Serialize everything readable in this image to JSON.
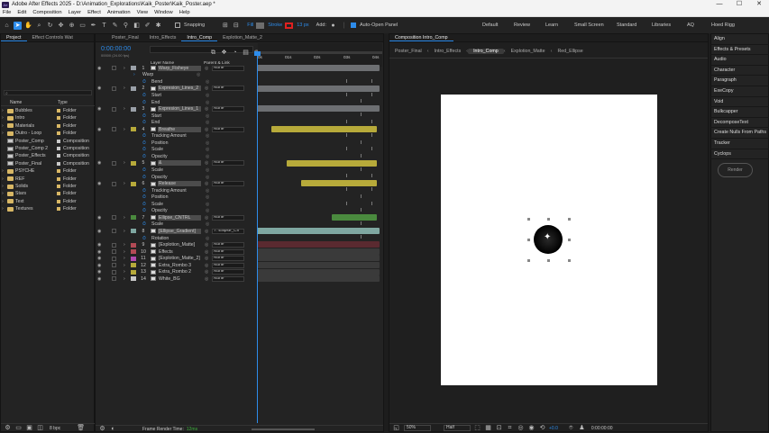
{
  "app": {
    "window_title": "Adobe After Effects 2025 - D:\\Animation_Explorations\\Kaik_Poster\\Kaik_Poster.aep *",
    "icon": "Ae"
  },
  "window_buttons": [
    "—",
    "☐",
    "✕"
  ],
  "menu": [
    "File",
    "Edit",
    "Composition",
    "Layer",
    "Effect",
    "Animation",
    "View",
    "Window",
    "Help"
  ],
  "toolbar": {
    "snapping": "Snapping",
    "fill": "Fill",
    "stroke": "Stroke",
    "stroke_width": "13 px",
    "add": "Add:",
    "auto_open": "Auto-Open Panel",
    "workspaces": [
      "Default",
      "Review",
      "Learn",
      "Small Screen",
      "Standard",
      "Libraries",
      "AQ",
      "Hoed Rigg"
    ]
  },
  "project": {
    "tabs": [
      "Project",
      "Effect Controls Wat"
    ],
    "search_placeholder": "",
    "col_name": "Name",
    "col_type": "Type",
    "items": [
      {
        "name": "Bubbles",
        "type": "Folder",
        "kind": "folder"
      },
      {
        "name": "Intro",
        "type": "Folder",
        "kind": "folder"
      },
      {
        "name": "Materials",
        "type": "Folder",
        "kind": "folder"
      },
      {
        "name": "Outro - Loop",
        "type": "Folder",
        "kind": "folder"
      },
      {
        "name": "Poster_Comp",
        "type": "Composition",
        "kind": "comp"
      },
      {
        "name": "Poster_Comp 2",
        "type": "Composition",
        "kind": "comp"
      },
      {
        "name": "Poster_Effects",
        "type": "Composition",
        "kind": "comp"
      },
      {
        "name": "Poster_Final",
        "type": "Composition",
        "kind": "comp"
      },
      {
        "name": "PSYCHE",
        "type": "Folder",
        "kind": "folder"
      },
      {
        "name": "REF",
        "type": "Folder",
        "kind": "folder"
      },
      {
        "name": "Solids",
        "type": "Folder",
        "kind": "folder"
      },
      {
        "name": "Stars",
        "type": "Folder",
        "kind": "folder"
      },
      {
        "name": "Text",
        "type": "Folder",
        "kind": "folder"
      },
      {
        "name": "Textures",
        "type": "Folder",
        "kind": "folder"
      }
    ],
    "bpc": "8 bpc"
  },
  "timeline": {
    "tabs": [
      "Poster_Final",
      "Intro_Effects",
      "Intro_Comp",
      "Explotion_Matte_2"
    ],
    "timecode": "0:00:00:00",
    "fps": "00000 (24.00 fps)",
    "col_layer_name": "Layer Name",
    "col_parent": "Parent & Link",
    "ruler": [
      "0s",
      "01s",
      "02s",
      "03s",
      "04s"
    ],
    "render_label": "Frame Render Time:",
    "render_time": "12ms",
    "rows": [
      {
        "num": "1",
        "name": "Warp_Fisheye",
        "parent": "None",
        "kind": "layer",
        "color": "#9aa0a8"
      },
      {
        "num": "",
        "name": "Warp",
        "parent": "",
        "kind": "group"
      },
      {
        "num": "",
        "name": "Bend",
        "parent": "",
        "kind": "prop"
      },
      {
        "num": "2",
        "name": "Expresion_Lines_2",
        "parent": "None",
        "kind": "layer",
        "color": "#9aa0a8"
      },
      {
        "num": "",
        "name": "Start",
        "parent": "",
        "kind": "prop"
      },
      {
        "num": "",
        "name": "End",
        "parent": "",
        "kind": "prop"
      },
      {
        "num": "3",
        "name": "Expresion_Lines_1",
        "parent": "None",
        "kind": "layer",
        "color": "#9aa0a8"
      },
      {
        "num": "",
        "name": "Start",
        "parent": "",
        "kind": "prop"
      },
      {
        "num": "",
        "name": "End",
        "parent": "",
        "kind": "prop"
      },
      {
        "num": "4",
        "name": "Breathe",
        "parent": "None",
        "kind": "layer",
        "color": "#b7aa3a"
      },
      {
        "num": "",
        "name": "Tracking Amount",
        "parent": "",
        "kind": "prop"
      },
      {
        "num": "",
        "name": "Position",
        "parent": "",
        "kind": "prop"
      },
      {
        "num": "",
        "name": "Scale",
        "parent": "",
        "kind": "prop"
      },
      {
        "num": "",
        "name": "Opacity",
        "parent": "",
        "kind": "prop"
      },
      {
        "num": "5",
        "name": "&",
        "parent": "None",
        "kind": "layer",
        "color": "#b7aa3a"
      },
      {
        "num": "",
        "name": "Scale",
        "parent": "",
        "kind": "prop"
      },
      {
        "num": "",
        "name": "Opacity",
        "parent": "",
        "kind": "prop"
      },
      {
        "num": "6",
        "name": "Release",
        "parent": "None",
        "kind": "layer",
        "color": "#b7aa3a"
      },
      {
        "num": "",
        "name": "Tracking Amount",
        "parent": "",
        "kind": "prop"
      },
      {
        "num": "",
        "name": "Position",
        "parent": "",
        "kind": "prop"
      },
      {
        "num": "",
        "name": "Scale",
        "parent": "",
        "kind": "prop"
      },
      {
        "num": "",
        "name": "Opacity",
        "parent": "",
        "kind": "prop"
      },
      {
        "num": "7",
        "name": "Ellipse_CNTRL",
        "parent": "None",
        "kind": "layer",
        "color": "#4a8a3e"
      },
      {
        "num": "",
        "name": "Scale",
        "parent": "",
        "kind": "prop"
      },
      {
        "num": "8",
        "name": "[Ellipse_Gradient]",
        "parent": "7. Ellipse_Ch",
        "kind": "layer",
        "color": "#7fa7a1"
      },
      {
        "num": "",
        "name": "Rotation",
        "parent": "",
        "kind": "prop"
      },
      {
        "num": "9",
        "name": "[Explotion_Matte]",
        "parent": "None",
        "kind": "layer",
        "color": "#b24a55"
      },
      {
        "num": "10",
        "name": "Effects",
        "parent": "None",
        "kind": "layer",
        "color": "#b24a55"
      },
      {
        "num": "11",
        "name": "[Explotion_Matte_2]",
        "parent": "None",
        "kind": "layer",
        "color": "#b24ab0"
      },
      {
        "num": "12",
        "name": "Extra_Rombo 3",
        "parent": "None",
        "kind": "layer",
        "color": "#b7aa3a"
      },
      {
        "num": "13",
        "name": "Extra_Rombo 2",
        "parent": "None",
        "kind": "layer",
        "color": "#b7aa3a"
      },
      {
        "num": "14",
        "name": "White_BG",
        "parent": "None",
        "kind": "layer",
        "color": "#c8c8c8"
      }
    ]
  },
  "composition": {
    "panel_tab": "Composition Intro_Comp",
    "tabs": [
      "Poster_Final",
      "Intro_Effects",
      "Intro_Comp",
      "Explotion_Matte",
      "Red_Ellipse"
    ],
    "zoom": "50%",
    "resolution": "Half",
    "exposure": "+0.0",
    "timecode": "0:00:00:00"
  },
  "right_panel": {
    "items": [
      "Align",
      "Effects & Presets",
      "Audio",
      "Character",
      "Paragraph",
      "ExeCopy",
      "Void",
      "Bulkcapper",
      "DecomposeText",
      "Create Nulls From Paths",
      "Tracker",
      "Cyclops"
    ],
    "render_button": "Render"
  },
  "colors": {
    "accent_blue": "#2d8ceb",
    "bar_yellow": "#b7aa3a",
    "bar_green": "#4a8a3e",
    "bar_gray": "#6d6f72",
    "bar_teal": "#7fa7a1"
  }
}
